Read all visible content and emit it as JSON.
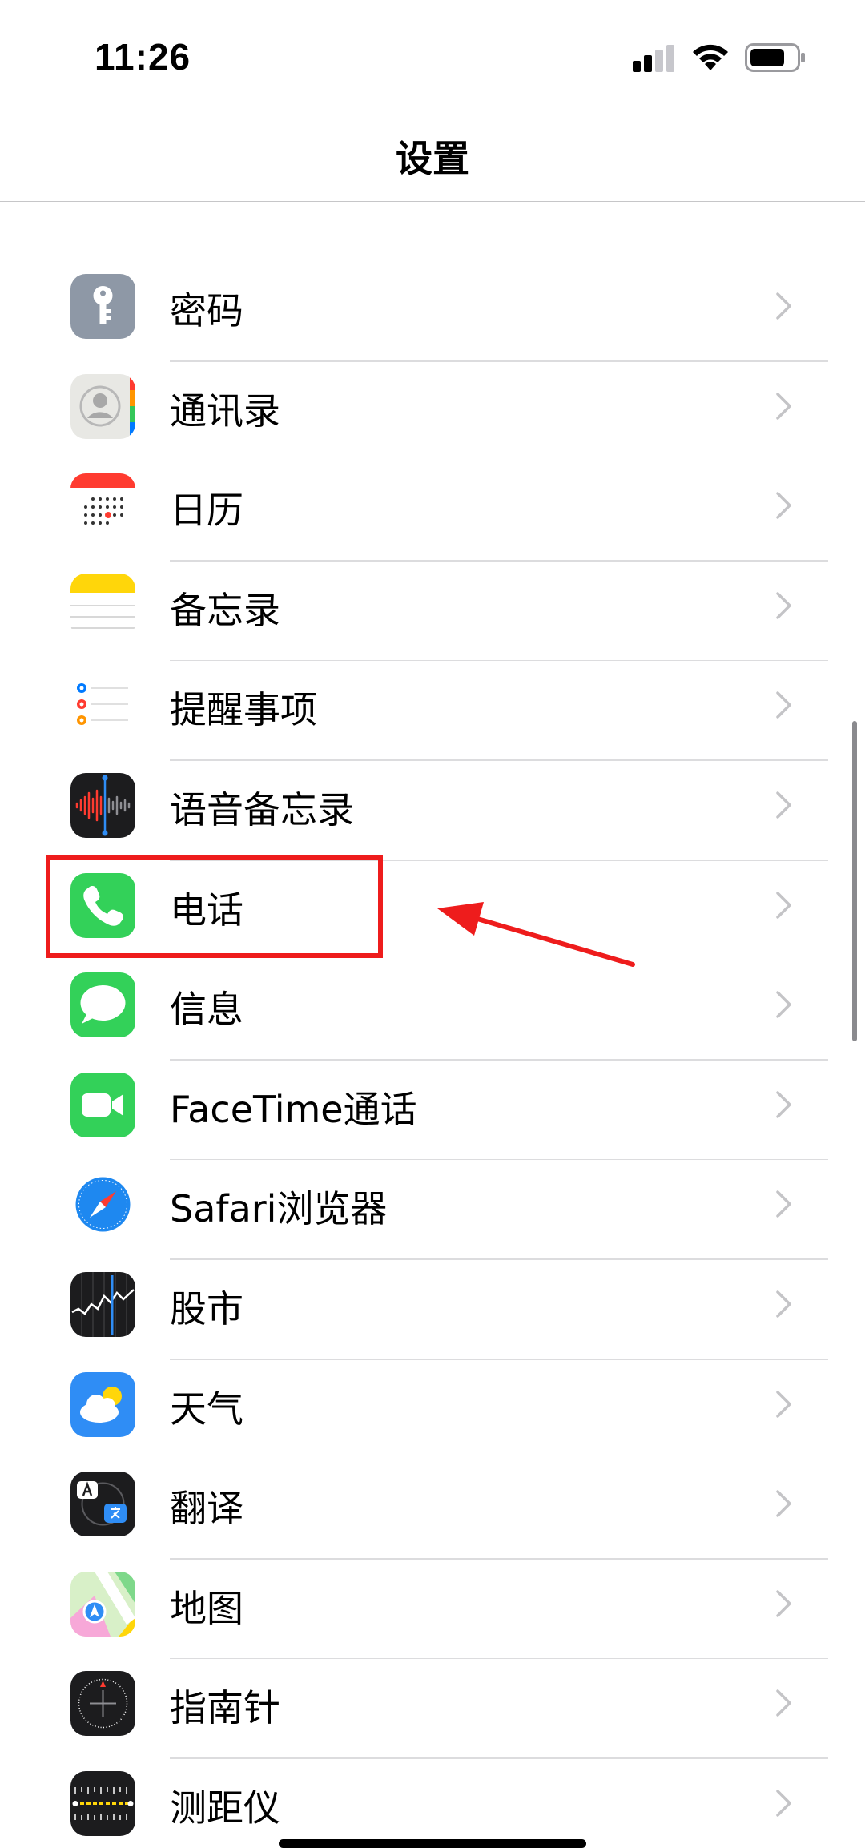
{
  "status_bar": {
    "time": "11:26",
    "battery_icon": "battery-icon",
    "wifi_icon": "wifi-icon",
    "signal_icon": "cellular-signal-icon"
  },
  "nav": {
    "title": "设置"
  },
  "settings_items": [
    {
      "label": "密码",
      "icon": "key-icon",
      "color": "#8e98a6"
    },
    {
      "label": "通讯录",
      "icon": "contacts-icon",
      "color": "#e4e4e0"
    },
    {
      "label": "日历",
      "icon": "calendar-icon",
      "color": "#ffffff"
    },
    {
      "label": "备忘录",
      "icon": "notes-icon",
      "color": "#ffd60a"
    },
    {
      "label": "提醒事项",
      "icon": "reminders-icon",
      "color": "#ffffff"
    },
    {
      "label": "语音备忘录",
      "icon": "voice-memos-icon",
      "color": "#1c1c1e"
    },
    {
      "label": "电话",
      "icon": "phone-icon",
      "color": "#33d159"
    },
    {
      "label": "信息",
      "icon": "messages-icon",
      "color": "#33d159"
    },
    {
      "label": "FaceTime通话",
      "icon": "facetime-icon",
      "color": "#33d159"
    },
    {
      "label": "Safari浏览器",
      "icon": "safari-icon",
      "color": "#1e88f0"
    },
    {
      "label": "股市",
      "icon": "stocks-icon",
      "color": "#1c1c1e"
    },
    {
      "label": "天气",
      "icon": "weather-icon",
      "color": "#2f8df5"
    },
    {
      "label": "翻译",
      "icon": "translate-icon",
      "color": "#1c1c1e"
    },
    {
      "label": "地图",
      "icon": "maps-icon",
      "color": "#7ed88a"
    },
    {
      "label": "指南针",
      "icon": "compass-icon",
      "color": "#1c1c1e"
    },
    {
      "label": "测距仪",
      "icon": "measure-icon",
      "color": "#1c1c1e"
    }
  ],
  "annotation": {
    "highlight_color": "#ee1c1c",
    "highlighted_item": "电话"
  }
}
